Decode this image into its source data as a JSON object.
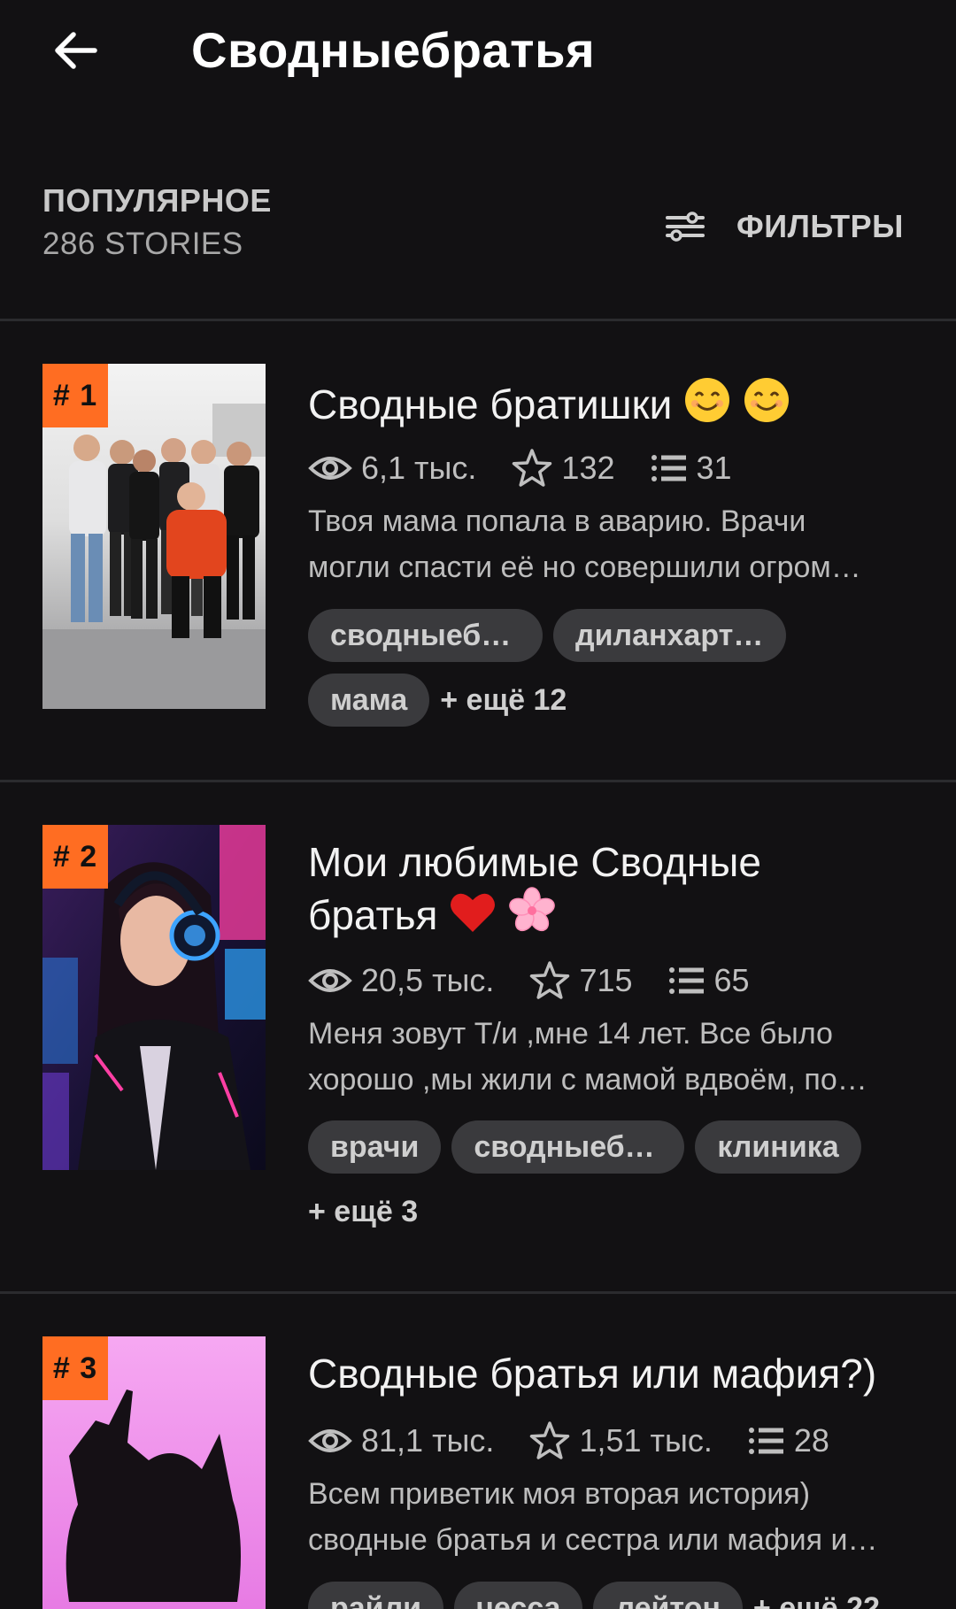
{
  "header": {
    "title": "Сводныебратья",
    "back_icon": "arrow-left-icon"
  },
  "section": {
    "label": "ПОПУЛЯРНОЕ",
    "count": "286 STORIES",
    "filters_label": "ФИЛЬТРЫ",
    "filters_icon": "sliders-icon"
  },
  "colors": {
    "background": "#121113",
    "rank_badge": "#ff6d22",
    "tag_bg": "#3a3a3d",
    "divider": "#2b2b2e"
  },
  "stories": [
    {
      "rank": "# 1",
      "title_line1": "Сводные братишки",
      "title_line2": "",
      "title_emojis": [
        "smiling-face-icon",
        "smiling-face-icon"
      ],
      "views": "6,1 тыс.",
      "votes": "132",
      "parts": "31",
      "desc_line1": "Твоя мама попала в аварию. Врачи",
      "desc_line2": "могли спасти её но совершили огром…",
      "tags": [
        "сводныеб…",
        "диланхарт…",
        "мама"
      ],
      "more": "+ ещё 12"
    },
    {
      "rank": "# 2",
      "title_line1": "Мои любимые Сводные",
      "title_line2": "братья",
      "title_emojis": [
        "red-heart-icon",
        "cherry-blossom-icon"
      ],
      "views": "20,5 тыс.",
      "votes": "715",
      "parts": "65",
      "desc_line1": "Меня зовут Т/и ,мне 14 лет. Все было",
      "desc_line2": "хорошо ,мы жили с мамой вдвоём, по…",
      "tags": [
        "врачи",
        "сводныеб…",
        "клиника"
      ],
      "more": "+ ещё 3"
    },
    {
      "rank": "# 3",
      "title_line1": "Сводные братья или мафия?)",
      "title_line2": "",
      "title_emojis": [],
      "views": "81,1 тыс.",
      "votes": "1,51 тыс.",
      "parts": "28",
      "desc_line1": "Всем приветик моя вторая история)",
      "desc_line2": "сводные братья и сестра или мафия и…",
      "tags": [
        "райли",
        "чесса",
        "лейтон"
      ],
      "more": "+ ещё 22"
    }
  ]
}
